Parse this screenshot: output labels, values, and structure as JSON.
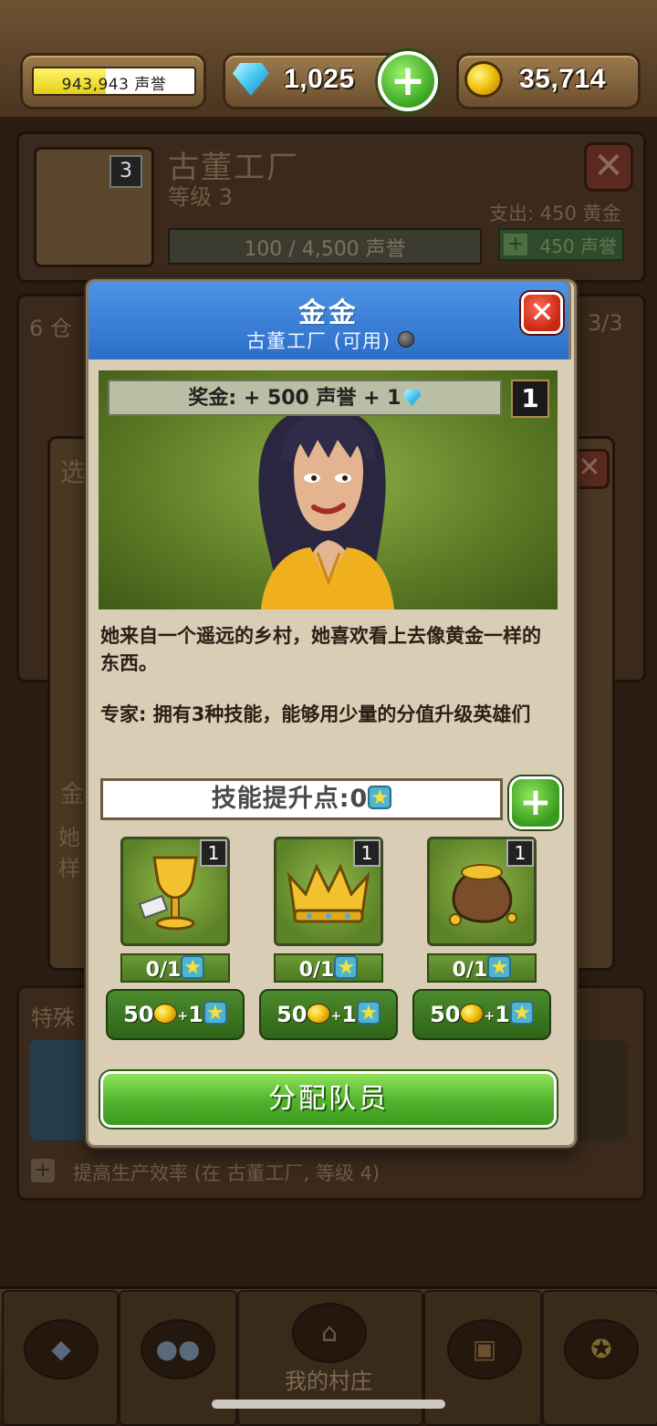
{
  "topbar": {
    "reputation_text": "943,943 声誉",
    "reputation_fill_fraction": 0.45,
    "gems": "1,025",
    "gold": "35,714"
  },
  "background": {
    "factory": {
      "title": "古董工厂",
      "level": "等级 3",
      "level_badge": "3",
      "expense": "支出: 450 黄金",
      "progress": "100 / 4,500 声誉",
      "upgrade_cost": "450 声誉"
    },
    "storage_label": "6 仓",
    "storage_count": "3/3",
    "choose_label": "选",
    "behind_name": "金",
    "behind_desc1": "她",
    "behind_desc2": "样",
    "special_label": "特殊",
    "special_text": "提高生产效率 (在 古董工厂, 等级 4)"
  },
  "modal": {
    "title": "金金",
    "subtitle": "古董工厂 (可用)",
    "bonus": "奖金: + 500 声誉 + 1",
    "level": "1",
    "description1": "她来自一个遥远的乡村，她喜欢看上去像黄金一样的东西。",
    "description2": "专家: 拥有3种技能，能够用少量的分值升级英雄们",
    "skill_points": "技能提升点:0",
    "skills": [
      {
        "icon": "goblet-icon",
        "level": "1",
        "progress": "0/1",
        "cost_gold": "50",
        "cost_points": "1"
      },
      {
        "icon": "crown-icon",
        "level": "1",
        "progress": "0/1",
        "cost_gold": "50",
        "cost_points": "1"
      },
      {
        "icon": "gold-sack-icon",
        "level": "1",
        "progress": "0/1",
        "cost_gold": "50",
        "cost_points": "1"
      }
    ],
    "assign_label": "分配队员"
  },
  "nav": {
    "active_label": "我的村庄",
    "items": [
      "gems-shop-icon",
      "team-icon",
      "home-icon",
      "treasure-chest-icon",
      "achievement-medal-icon"
    ]
  },
  "colors": {
    "modal_header": "#3b82dc",
    "confirm_green": "#4fb22c",
    "portrait_bg": "#6f8f30"
  }
}
